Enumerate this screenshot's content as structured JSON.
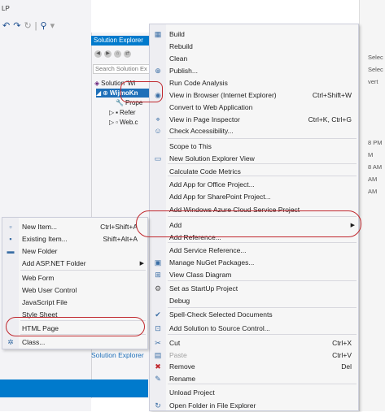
{
  "ide": {
    "top_left_text": "LP",
    "solution_explorer_title": "Solution Explorer",
    "search_placeholder": "Search Solution Ex",
    "solution_item": "Solution 'Wi",
    "project_item": "WijmoKn",
    "tree_items": [
      "Prope",
      "Refer",
      "Web.c"
    ],
    "bottom_tab": "Solution Explorer",
    "right_texts": [
      "Selec",
      "Selec",
      "vert",
      "8 PM",
      "M",
      "8 AM",
      "AM",
      "AM"
    ]
  },
  "main_menu": {
    "items": [
      {
        "label": "Build",
        "shortcut": "",
        "icon": "build-icon",
        "glyph": "▦"
      },
      {
        "label": "Rebuild",
        "shortcut": "",
        "icon": "",
        "glyph": ""
      },
      {
        "label": "Clean",
        "shortcut": "",
        "icon": "",
        "glyph": ""
      },
      {
        "label": "Publish...",
        "shortcut": "",
        "icon": "publish-icon",
        "glyph": "⊕"
      },
      {
        "label": "Run Code Analysis",
        "shortcut": "",
        "icon": "",
        "glyph": ""
      },
      {
        "label": "View in Browser (Internet Explorer)",
        "shortcut": "Ctrl+Shift+W",
        "icon": "browser-icon",
        "glyph": "◉"
      },
      {
        "label": "Convert to Web Application",
        "shortcut": "",
        "icon": "",
        "glyph": ""
      },
      {
        "label": "View in Page Inspector",
        "shortcut": "Ctrl+K, Ctrl+G",
        "icon": "inspector-icon",
        "glyph": "⌖"
      },
      {
        "label": "Check Accessibility...",
        "shortcut": "",
        "icon": "accessibility-icon",
        "glyph": "☺"
      },
      {
        "label": "Scope to This",
        "shortcut": "",
        "icon": "",
        "glyph": ""
      },
      {
        "label": "New Solution Explorer View",
        "shortcut": "",
        "icon": "new-view-icon",
        "glyph": "▭"
      },
      {
        "label": "Calculate Code Metrics",
        "shortcut": "",
        "icon": "",
        "glyph": ""
      },
      {
        "label": "Add App for Office Project...",
        "shortcut": "",
        "icon": "",
        "glyph": ""
      },
      {
        "label": "Add App for SharePoint Project...",
        "shortcut": "",
        "icon": "",
        "glyph": ""
      },
      {
        "label": "Add Windows Azure Cloud Service Project",
        "shortcut": "",
        "icon": "",
        "glyph": ""
      },
      {
        "label": "Add",
        "shortcut": "",
        "icon": "",
        "glyph": ""
      },
      {
        "label": "Add Reference...",
        "shortcut": "",
        "icon": "",
        "glyph": ""
      },
      {
        "label": "Add Service Reference...",
        "shortcut": "",
        "icon": "",
        "glyph": ""
      },
      {
        "label": "Manage NuGet Packages...",
        "shortcut": "",
        "icon": "nuget-icon",
        "glyph": "▣"
      },
      {
        "label": "View Class Diagram",
        "shortcut": "",
        "icon": "class-diagram-icon",
        "glyph": "⊞"
      },
      {
        "label": "Set as StartUp Project",
        "shortcut": "",
        "icon": "startup-icon",
        "glyph": "⚙"
      },
      {
        "label": "Debug",
        "shortcut": "",
        "icon": "",
        "glyph": ""
      },
      {
        "label": "Spell-Check Selected Documents",
        "shortcut": "",
        "icon": "spellcheck-icon",
        "glyph": "✔"
      },
      {
        "label": "Add Solution to Source Control...",
        "shortcut": "",
        "icon": "source-control-icon",
        "glyph": "⊡"
      },
      {
        "label": "Cut",
        "shortcut": "Ctrl+X",
        "icon": "cut-icon",
        "glyph": "✂"
      },
      {
        "label": "Paste",
        "shortcut": "Ctrl+V",
        "icon": "paste-icon",
        "glyph": "▤"
      },
      {
        "label": "Remove",
        "shortcut": "Del",
        "icon": "remove-icon",
        "glyph": "✖"
      },
      {
        "label": "Rename",
        "shortcut": "",
        "icon": "rename-icon",
        "glyph": "✎"
      },
      {
        "label": "Unload Project",
        "shortcut": "",
        "icon": "",
        "glyph": ""
      },
      {
        "label": "Open Folder in File Explorer",
        "shortcut": "",
        "icon": "open-folder-icon",
        "glyph": "↻"
      }
    ]
  },
  "sub_menu": {
    "items": [
      {
        "label": "New Item...",
        "shortcut": "Ctrl+Shift+A",
        "icon": "new-item-icon",
        "glyph": "▫"
      },
      {
        "label": "Existing Item...",
        "shortcut": "Shift+Alt+A",
        "icon": "existing-item-icon",
        "glyph": "▪"
      },
      {
        "label": "New Folder",
        "shortcut": "",
        "icon": "new-folder-icon",
        "glyph": "▬"
      },
      {
        "label": "Add ASP.NET Folder",
        "shortcut": "",
        "icon": "",
        "glyph": ""
      },
      {
        "label": "Web Form",
        "shortcut": "",
        "icon": "",
        "glyph": ""
      },
      {
        "label": "Web User Control",
        "shortcut": "",
        "icon": "",
        "glyph": ""
      },
      {
        "label": "JavaScript File",
        "shortcut": "",
        "icon": "",
        "glyph": ""
      },
      {
        "label": "Style Sheet",
        "shortcut": "",
        "icon": "",
        "glyph": ""
      },
      {
        "label": "HTML Page",
        "shortcut": "",
        "icon": "",
        "glyph": ""
      },
      {
        "label": "Class...",
        "shortcut": "",
        "icon": "class-icon",
        "glyph": "✲"
      }
    ]
  }
}
